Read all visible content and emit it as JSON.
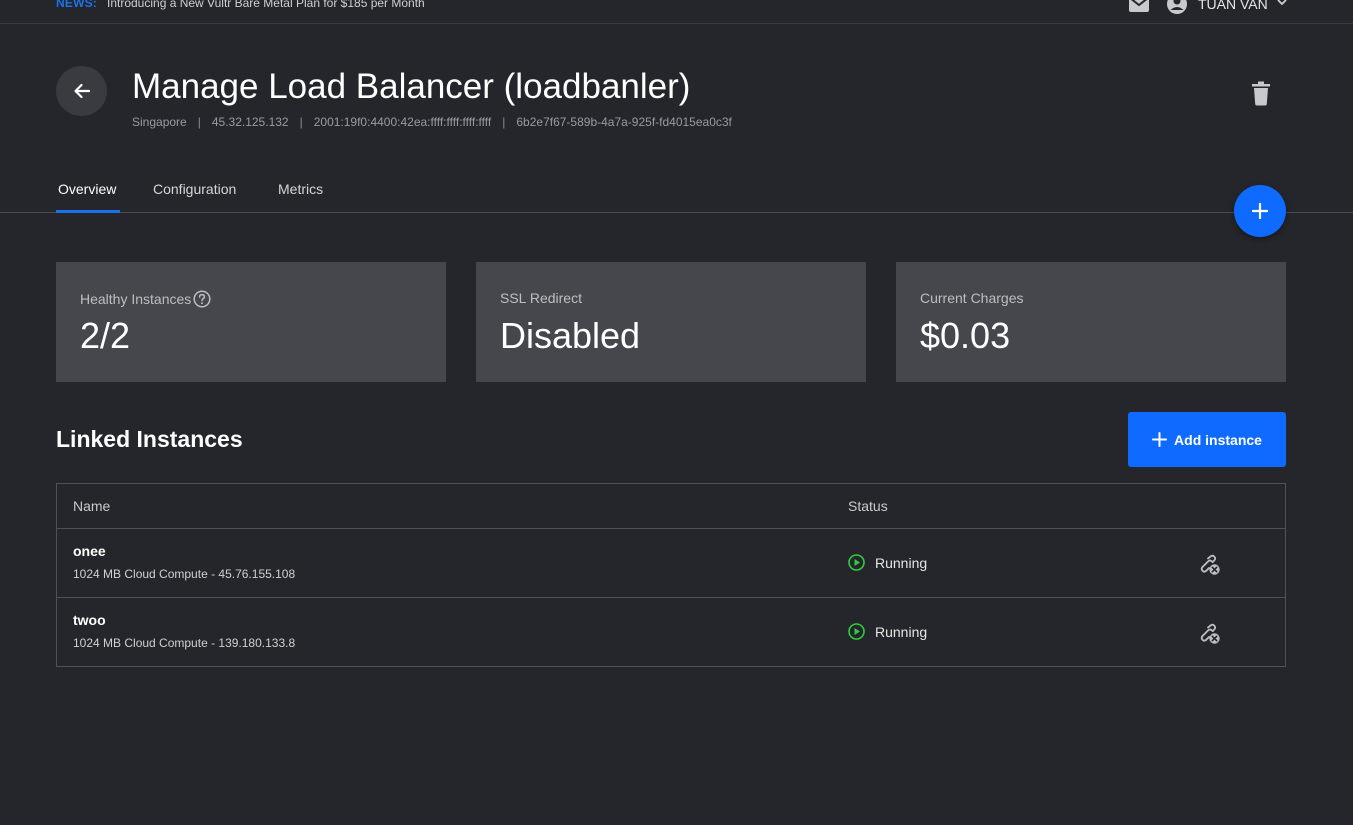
{
  "news": {
    "tag": "NEWS:",
    "text": "Introducing a New Vultr Bare Metal Plan for $185 per Month"
  },
  "user": {
    "name": "TUAN VAN"
  },
  "header": {
    "title": "Manage Load Balancer (loadbanler)",
    "location": "Singapore",
    "ipv4": "45.32.125.132",
    "ipv6": "2001:19f0:4400:42ea:ffff:ffff:ffff:ffff",
    "id": "6b2e7f67-589b-4a7a-925f-fd4015ea0c3f",
    "separator": "|"
  },
  "tabs": [
    {
      "label": "Overview",
      "active": true
    },
    {
      "label": "Configuration",
      "active": false
    },
    {
      "label": "Metrics",
      "active": false
    }
  ],
  "cards": {
    "healthy": {
      "label": "Healthy Instances",
      "value": "2/2"
    },
    "ssl": {
      "label": "SSL Redirect",
      "value": "Disabled"
    },
    "charges": {
      "label": "Current Charges",
      "value": "$0.03"
    }
  },
  "linked": {
    "title": "Linked Instances",
    "add_label": "Add instance",
    "columns": {
      "name": "Name",
      "status": "Status"
    },
    "rows": [
      {
        "name": "onee",
        "detail": "1024 MB Cloud Compute - 45.76.155.108",
        "status": "Running"
      },
      {
        "name": "twoo",
        "detail": "1024 MB Cloud Compute - 139.180.133.8",
        "status": "Running"
      }
    ]
  },
  "colors": {
    "background": "#25262b",
    "card": "#46474c",
    "accent": "#0f6bff",
    "running": "#2ecc40"
  },
  "icons": [
    "mail-icon",
    "user-icon",
    "chevron-down-icon",
    "arrow-left-icon",
    "trash-icon",
    "plus-icon",
    "help-icon",
    "play-circle-icon",
    "unlink-icon"
  ]
}
